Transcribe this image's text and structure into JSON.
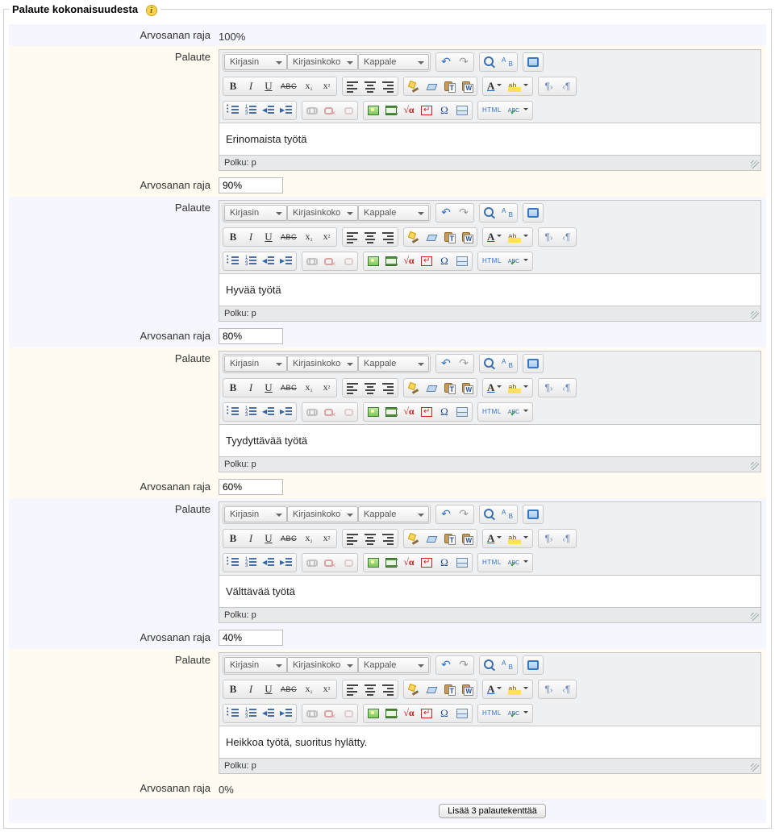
{
  "legend": "Palaute kokonaisuudesta",
  "labels": {
    "boundary": "Arvosanan raja",
    "feedback": "Palaute"
  },
  "toolbar": {
    "font": "Kirjasin",
    "fontsize": "Kirjasinkoko",
    "format": "Kappale",
    "path_label": "Polku: p",
    "html": "HTML"
  },
  "items": [
    {
      "boundary_static": "100%",
      "boundary_input": null,
      "content": "Erinomaista työtä"
    },
    {
      "boundary_static": null,
      "boundary_input": "90%",
      "content": "Hyvää työtä"
    },
    {
      "boundary_static": null,
      "boundary_input": "80%",
      "content": "Tyydyttävää työtä"
    },
    {
      "boundary_static": null,
      "boundary_input": "60%",
      "content": "Välttävää työtä"
    },
    {
      "boundary_static": null,
      "boundary_input": "40%",
      "content": "Heikkoa työtä, suoritus hylätty."
    }
  ],
  "final_boundary": "0%",
  "add_button": "Lisää 3 palautekenttää"
}
